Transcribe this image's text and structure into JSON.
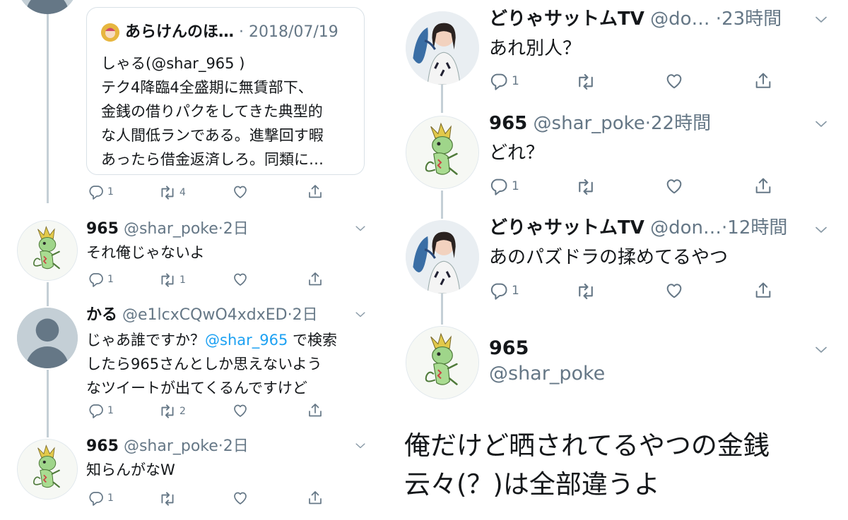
{
  "left": {
    "quote": {
      "author": "あらけんのほ…",
      "date": "2018/07/19",
      "text": "しゃる(@shar_965 )\nテク4降臨4全盛期に無賃部下、\n金銭の借りパクをしてきた典型的\nな人間低ランである。進撃回す暇\nあったら借金返済しろ。同類に…",
      "actions": {
        "reply": "1",
        "retweet": "4"
      }
    },
    "tweets": [
      {
        "name": "965",
        "handle": "@shar_poke",
        "time": "2日",
        "text": "それ俺じゃないよ",
        "reply_count": "1",
        "retweet_count": "1"
      },
      {
        "name": "かる",
        "handle": "@e1lcxCQwO4xdxED",
        "time": "2日",
        "text_before": "じゃあ誰ですか？",
        "mention": "@shar_965",
        "text_after": " で検索\nしたら965さんとしか思えないよう\nなツイートが出てくるんですけど",
        "reply_count": "1",
        "retweet_count": "2"
      },
      {
        "name": "965",
        "handle": "@shar_poke",
        "time": "2日",
        "text": "知らんがなW",
        "reply_count": "1",
        "retweet_count": ""
      }
    ]
  },
  "right": {
    "tweets": [
      {
        "name": "どりゃサットムTV",
        "handle": "@do…",
        "time": "23時間",
        "text": "あれ別人？",
        "reply_count": "1"
      },
      {
        "name": "965",
        "handle": "@shar_poke",
        "time": "22時間",
        "text": "どれ？",
        "reply_count": "1"
      },
      {
        "name": "どりゃサットムTV",
        "handle": "@don…",
        "time": "12時間",
        "text": "あのパズドラの揉めてるやつ",
        "reply_count": "1"
      }
    ],
    "main": {
      "name": "965",
      "handle": "@shar_poke",
      "text": "俺だけど晒されてるやつの金銭\n云々(？)は全部違うよ"
    }
  },
  "colors": {
    "text": "#14171a",
    "secondary": "#657786",
    "link": "#1da1f2",
    "line": "#c4cfd6",
    "border": "#d9e1e7"
  }
}
